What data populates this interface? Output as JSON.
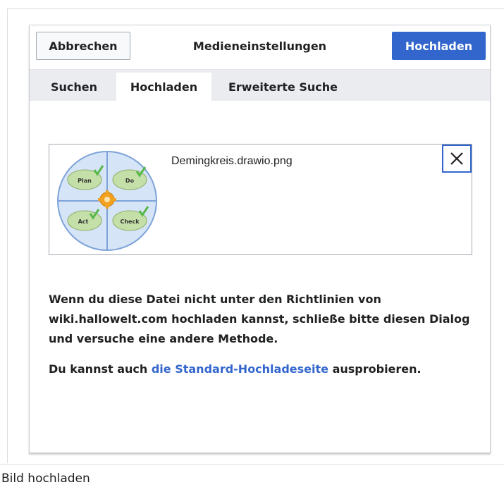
{
  "dialog": {
    "cancel_label": "Abbrechen",
    "title": "Medieneinstellungen",
    "upload_label": "Hochladen"
  },
  "tabs": [
    {
      "label": "Suchen",
      "active": false
    },
    {
      "label": "Hochladen",
      "active": true
    },
    {
      "label": "Erweiterte Suche",
      "active": false
    }
  ],
  "file": {
    "name": "Demingkreis.drawio.png",
    "thumb_labels": {
      "plan": "Plan",
      "do": "Do",
      "act": "Act",
      "check": "Check"
    },
    "remove_icon": "close-icon"
  },
  "message": {
    "line1": "Wenn du diese Datei nicht unter den Richtlinien von wiki.hallowelt.com hochladen kannst, schließe bitte diesen Dialog und versuche eine andere Methode.",
    "line2_prefix": "Du kannst auch ",
    "line2_link": "die Standard-Hochladeseite",
    "line2_suffix": " ausprobieren."
  },
  "caption": "Bild hochladen",
  "colors": {
    "accent": "#3366cc",
    "tabbar": "#eaecf0",
    "border": "#a2a9b1"
  }
}
